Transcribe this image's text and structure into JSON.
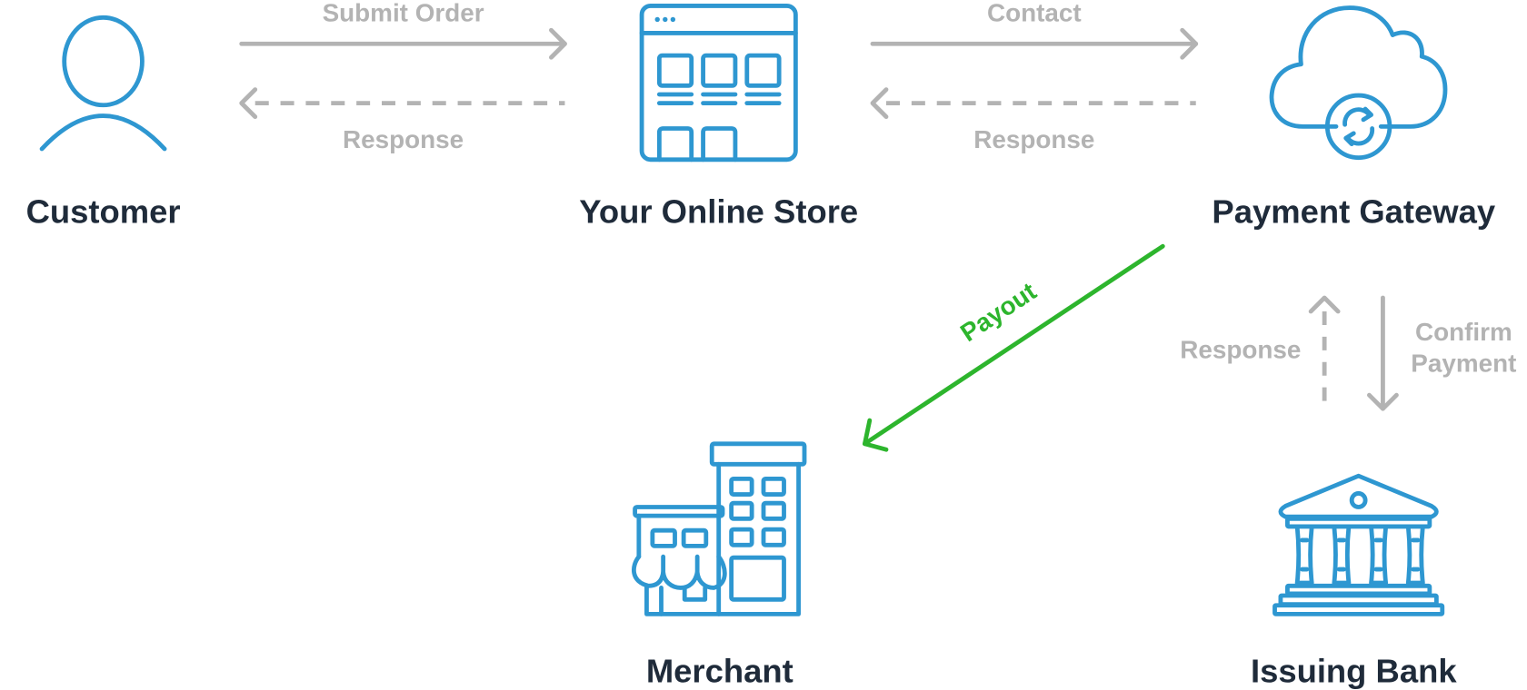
{
  "colors": {
    "icon": "#2e97d1",
    "node_text": "#1f2b3a",
    "edge_gray": "#b3b3b3",
    "payout_green": "#2db52d",
    "background": "#ffffff"
  },
  "nodes": {
    "customer": {
      "label": "Customer",
      "icon": "person-icon"
    },
    "store": {
      "label": "Your Online Store",
      "icon": "browser-store-icon"
    },
    "gateway": {
      "label": "Payment Gateway",
      "icon": "cloud-sync-icon"
    },
    "merchant": {
      "label": "Merchant",
      "icon": "buildings-icon"
    },
    "bank": {
      "label": "Issuing Bank",
      "icon": "bank-icon"
    }
  },
  "edges": {
    "submit_order": {
      "label": "Submit Order",
      "from": "customer",
      "to": "store",
      "style": "solid"
    },
    "store_response": {
      "label": "Response",
      "from": "store",
      "to": "customer",
      "style": "dashed"
    },
    "contact": {
      "label": "Contact",
      "from": "store",
      "to": "gateway",
      "style": "solid"
    },
    "gateway_response": {
      "label": "Response",
      "from": "gateway",
      "to": "store",
      "style": "dashed"
    },
    "payout": {
      "label": "Payout",
      "from": "gateway",
      "to": "merchant",
      "style": "solid-green"
    },
    "bank_response": {
      "label": "Response",
      "from": "bank",
      "to": "gateway",
      "style": "dashed"
    },
    "confirm_payment": {
      "label_line1": "Confirm",
      "label_line2": "Payment",
      "from": "gateway",
      "to": "bank",
      "style": "solid"
    }
  }
}
